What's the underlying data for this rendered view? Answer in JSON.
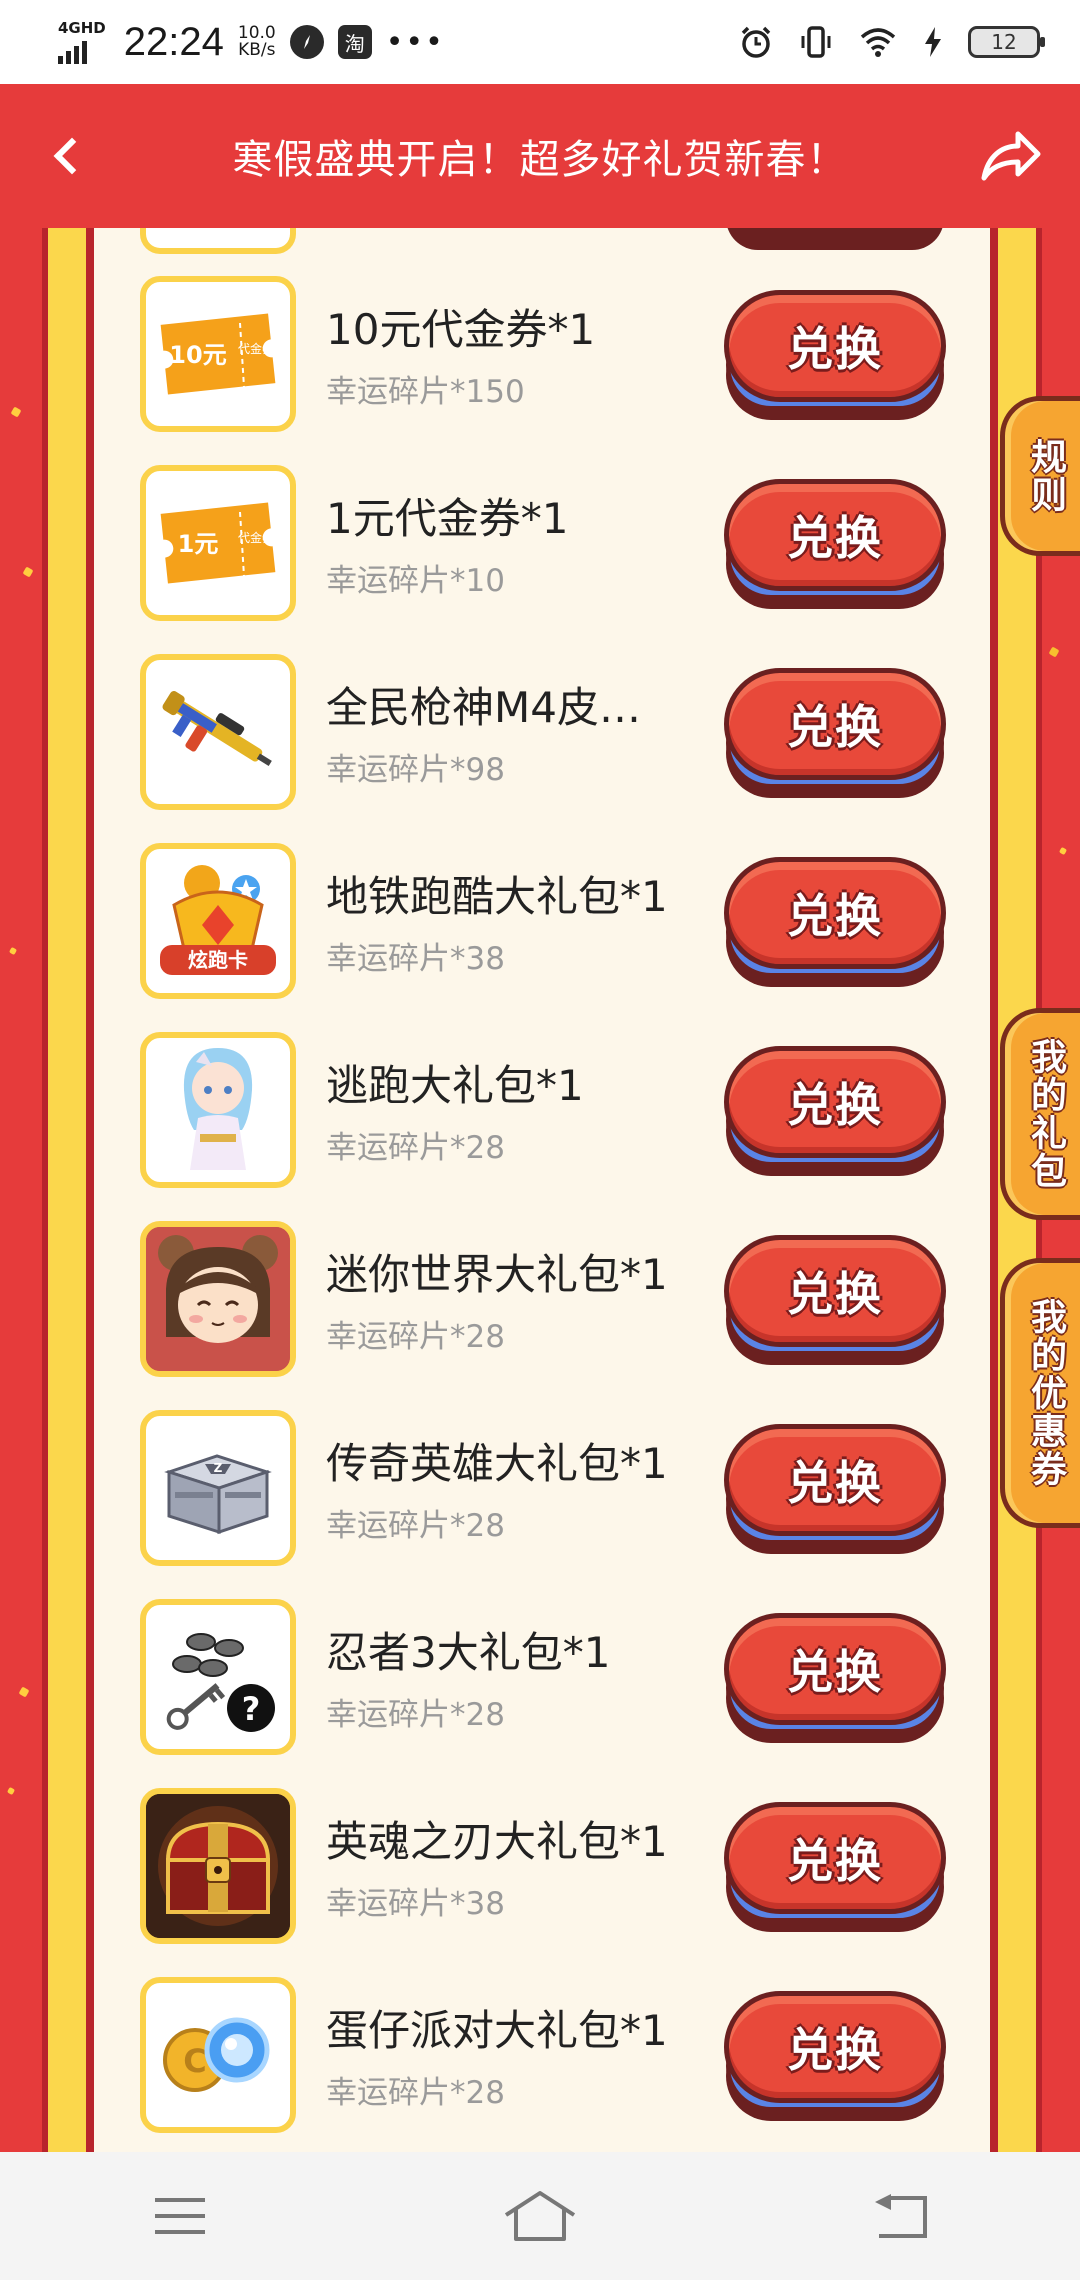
{
  "status_bar": {
    "network": "4GHD",
    "time": "22:24",
    "speed_value": "10.0",
    "speed_unit": "KB/s",
    "app_icon_2": "淘",
    "more": "•••",
    "battery": "12"
  },
  "header": {
    "title": "寒假盛典开启！超多好礼贺新春！"
  },
  "items": [
    {
      "name": "10元代金券*1",
      "cost": "幸运碎片*150",
      "button": "兑换",
      "thumb_text": "10元",
      "thumb_sub": "代金券"
    },
    {
      "name": "1元代金券*1",
      "cost": "幸运碎片*10",
      "button": "兑换",
      "thumb_text": "1元",
      "thumb_sub": "代金券"
    },
    {
      "name": "全民枪神M4皮…",
      "cost": "幸运碎片*98",
      "button": "兑换"
    },
    {
      "name": "地铁跑酷大礼包*1",
      "cost": "幸运碎片*38",
      "button": "兑换",
      "thumb_text": "炫跑卡"
    },
    {
      "name": "逃跑大礼包*1",
      "cost": "幸运碎片*28",
      "button": "兑换"
    },
    {
      "name": "迷你世界大礼包*1",
      "cost": "幸运碎片*28",
      "button": "兑换"
    },
    {
      "name": "传奇英雄大礼包*1",
      "cost": "幸运碎片*28",
      "button": "兑换"
    },
    {
      "name": "忍者3大礼包*1",
      "cost": "幸运碎片*28",
      "button": "兑换"
    },
    {
      "name": "英魂之刃大礼包*1",
      "cost": "幸运碎片*38",
      "button": "兑换"
    },
    {
      "name": "蛋仔派对大礼包*1",
      "cost": "幸运碎片*28",
      "button": "兑换"
    }
  ],
  "side_tabs": {
    "rules": "规则",
    "my_gifts": "我的礼包",
    "my_coupons": "我的优惠券"
  },
  "colors": {
    "brand_red": "#e63b3b",
    "frame_yellow": "#fbd74c",
    "panel_cream": "#fdf7ea",
    "button_red": "#e8493a",
    "tab_orange": "#f6a531"
  }
}
